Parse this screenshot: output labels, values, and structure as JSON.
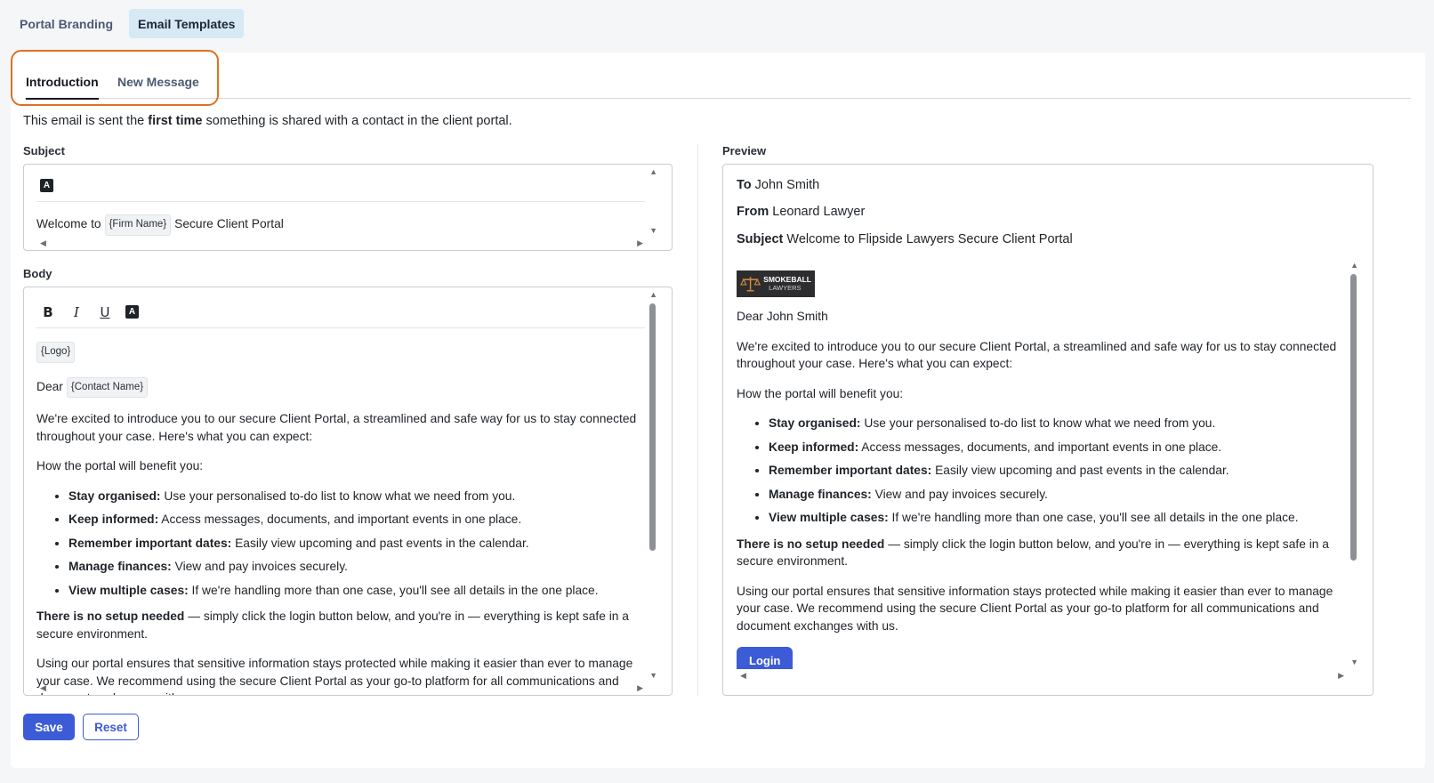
{
  "top_tabs": [
    "Portal Branding",
    "Email Templates"
  ],
  "sub_tabs": [
    "Introduction",
    "New Message"
  ],
  "intro": {
    "prefix": "This email is sent the ",
    "bold": "first time",
    "suffix": " something is shared with a contact in the client portal."
  },
  "subject": {
    "label": "Subject",
    "prefix": "Welcome to",
    "tag": "{Firm Name}",
    "suffix": "Secure Client Portal"
  },
  "body": {
    "label": "Body",
    "logo_tag": "{Logo}",
    "dear": "Dear",
    "contact_tag": "{Contact Name}"
  },
  "email": {
    "intro_paragraph": "We're excited to introduce you to our secure Client Portal, a streamlined and safe way for us to stay connected throughout your case. Here's what you can expect:",
    "benefit_heading": "How the portal will benefit you:",
    "benefits": [
      {
        "title": "Stay organised:",
        "text": " Use your personalised to-do list to know what we need from you."
      },
      {
        "title": "Keep informed:",
        "text": " Access messages, documents, and important events in one place."
      },
      {
        "title": "Remember important dates:",
        "text": " Easily view upcoming and past events in the calendar."
      },
      {
        "title": "Manage finances:",
        "text": " View and pay invoices securely."
      },
      {
        "title": "View multiple cases:",
        "text": " If we're handling more than one case, you'll see all details in the one place."
      }
    ],
    "setup_bold": "There is no setup needed",
    "setup_text": " — simply click the login button below, and you're in — everything is kept safe in a secure environment.",
    "closing_paragraph": "Using our portal ensures that sensitive information stays protected while making it easier than ever to manage your case. We recommend using the secure Client Portal as your go-to platform for all communications and document exchanges with us.",
    "login_label": "Login"
  },
  "preview": {
    "label": "Preview",
    "to_label": "To",
    "to_value": "John Smith",
    "from_label": "From",
    "from_value": "Leonard Lawyer",
    "subject_label": "Subject",
    "subject_value": "Welcome to Flipside Lawyers Secure Client Portal",
    "logo_line1": "SMOKEBALL",
    "logo_line2": "LAWYERS",
    "greeting": "Dear John Smith"
  },
  "buttons": {
    "save": "Save",
    "reset": "Reset"
  },
  "colors": {
    "accent": "#3c5bd6",
    "highlight": "#e07023",
    "active_tab_bg": "#d6e9f4"
  }
}
